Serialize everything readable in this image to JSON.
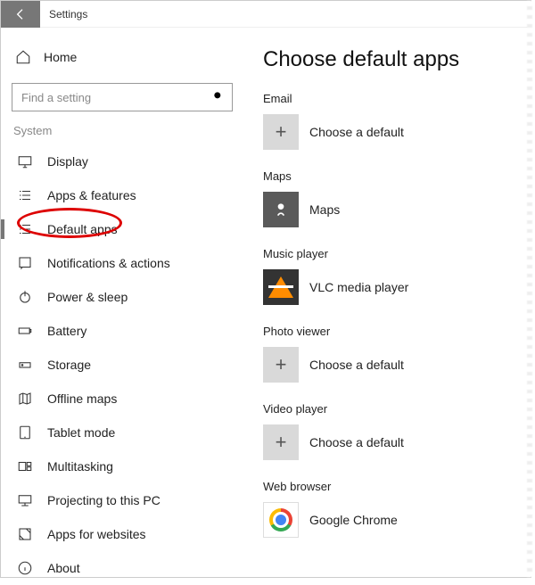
{
  "window": {
    "title": "Settings"
  },
  "sidebar": {
    "home_label": "Home",
    "search_placeholder": "Find a setting",
    "section_label": "System",
    "items": [
      {
        "label": "Display"
      },
      {
        "label": "Apps & features"
      },
      {
        "label": "Default apps"
      },
      {
        "label": "Notifications & actions"
      },
      {
        "label": "Power & sleep"
      },
      {
        "label": "Battery"
      },
      {
        "label": "Storage"
      },
      {
        "label": "Offline maps"
      },
      {
        "label": "Tablet mode"
      },
      {
        "label": "Multitasking"
      },
      {
        "label": "Projecting to this PC"
      },
      {
        "label": "Apps for websites"
      },
      {
        "label": "About"
      }
    ],
    "selected_index": 2
  },
  "main": {
    "heading": "Choose default apps",
    "categories": [
      {
        "label": "Email",
        "app": "Choose a default",
        "tile": "plus"
      },
      {
        "label": "Maps",
        "app": "Maps",
        "tile": "maps"
      },
      {
        "label": "Music player",
        "app": "VLC media player",
        "tile": "vlc"
      },
      {
        "label": "Photo viewer",
        "app": "Choose a default",
        "tile": "plus"
      },
      {
        "label": "Video player",
        "app": "Choose a default",
        "tile": "plus"
      },
      {
        "label": "Web browser",
        "app": "Google Chrome",
        "tile": "chrome"
      }
    ]
  }
}
